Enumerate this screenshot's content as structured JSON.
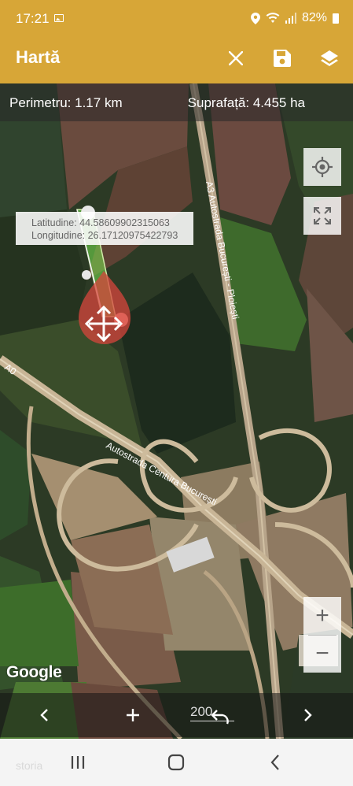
{
  "status_bar": {
    "time": "17:21",
    "battery": "82%",
    "icons": [
      "image-icon",
      "location-icon",
      "wifi-icon",
      "signal-icon",
      "battery-icon"
    ]
  },
  "app_bar": {
    "title": "Hartă",
    "actions": [
      "close-icon",
      "save-icon",
      "layers-icon"
    ],
    "color": "#d7a637"
  },
  "measure": {
    "perimeter": "Perimetru: 1.17 km",
    "area": "Suprafață: 4.455 ha"
  },
  "point": {
    "lat": "Latitudine: 44.58609902315063",
    "lon": "Longitudine: 26.17120975422793"
  },
  "map_labels": {
    "a3": "A3 Autostrada București - Ploiești",
    "centura": "Autostrada Centura București",
    "a0": "A0",
    "provider": "Google"
  },
  "map_controls": {
    "zoom_in": "+",
    "zoom_out": "−",
    "locate": "my-location-icon",
    "fullscreen": "fullscreen-icon"
  },
  "bottom_controls": {
    "prev": "chevron-left-icon",
    "add": "+",
    "step_value": "200",
    "undo": "undo-icon",
    "next": "chevron-right-icon"
  },
  "nav_bar": {
    "ghost_text": "storia",
    "buttons": [
      "recent-apps-icon",
      "home-icon",
      "back-icon"
    ]
  }
}
